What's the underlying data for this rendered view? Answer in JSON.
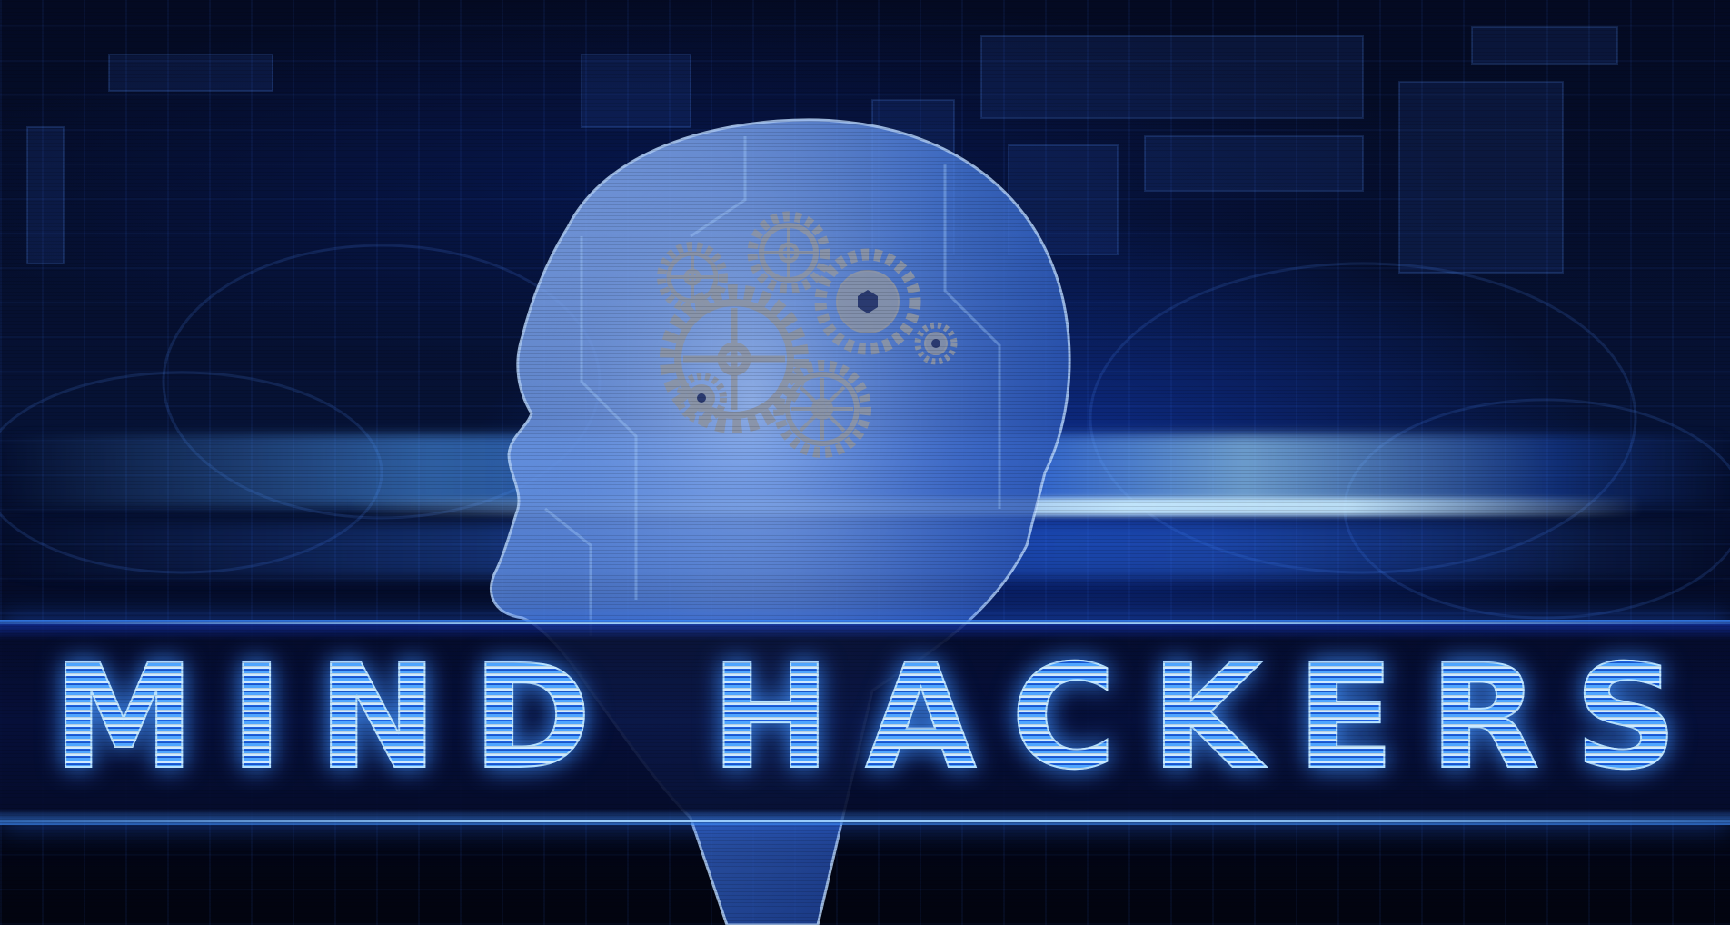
{
  "title": "MIND HACKERS",
  "palette": {
    "background": "#040a22",
    "accent": "#2f7bff",
    "glow": "#8fcfff",
    "gear": "#8a93a6"
  },
  "icons": [
    "head-silhouette-icon",
    "gears-icon"
  ]
}
